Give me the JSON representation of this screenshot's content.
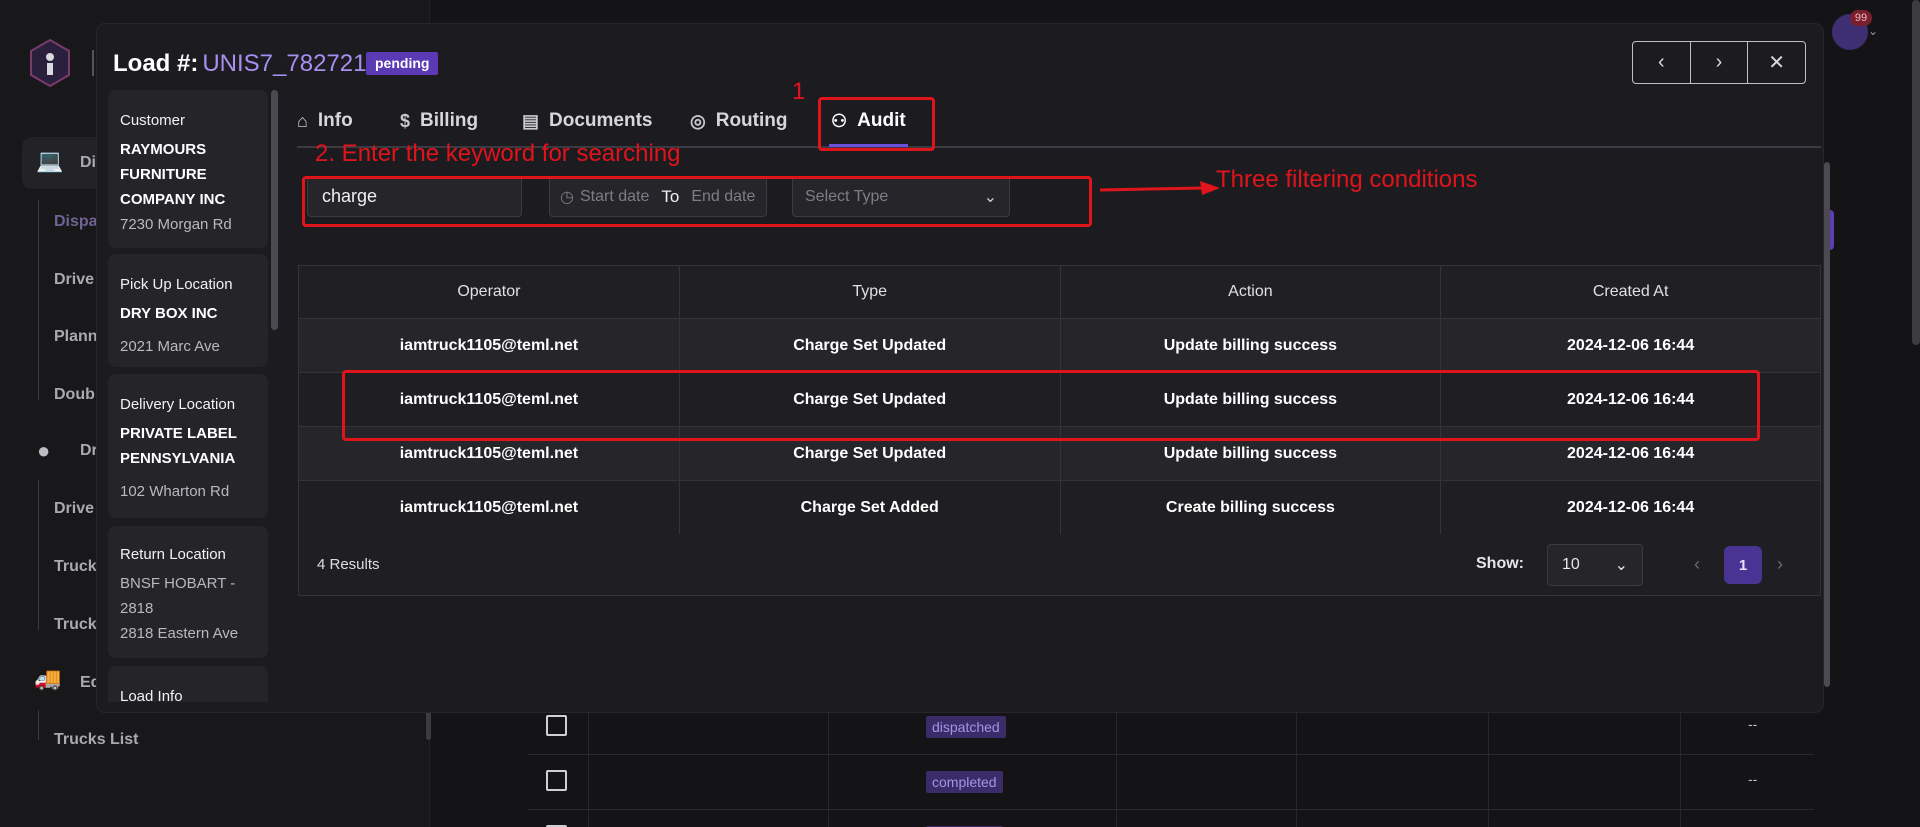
{
  "background": {
    "nav": {
      "group1_label": "Di",
      "dispatch_label": "Dispa",
      "drivers_label": "Drive",
      "planning_label": "Plann",
      "double_label": "Doub",
      "group2_label": "Dr",
      "drivers2_label": "Drive",
      "trucks1_label": "Truck",
      "trucks2_label": "Truck",
      "group3_label": "Eq",
      "trucks_list_label": "Trucks List"
    },
    "notification_count": "99",
    "rows": [
      {
        "status": "dispatched",
        "dash": "--"
      },
      {
        "status": "completed",
        "dash": "--"
      },
      {
        "status": "completed",
        "dash": "--"
      }
    ]
  },
  "modal": {
    "title_label": "Load #:",
    "load_id": "UNIS7_782721",
    "status_badge": "pending",
    "nav": {
      "prev": "‹",
      "next": "›",
      "close": "✕"
    },
    "info_cards": [
      {
        "title": "Customer",
        "name": "RAYMOURS FURNITURE COMPANY INC",
        "sub": "7230 Morgan Rd"
      },
      {
        "title": "Pick Up Location",
        "name": "DRY BOX INC",
        "sub": "2021 Marc Ave"
      },
      {
        "title": "Delivery Location",
        "name": "PRIVATE LABEL PENNSYLVANIA",
        "sub": "102 Wharton Rd"
      },
      {
        "title": "Return Location",
        "name": "",
        "sub": "BNSF HOBART - 2818",
        "sub2": "2818 Eastern Ave"
      },
      {
        "title": "Load Info",
        "name": "",
        "sub": ""
      }
    ],
    "tabs": [
      {
        "label": "Info",
        "icon": "home-icon"
      },
      {
        "label": "Billing",
        "icon": "dollar-icon"
      },
      {
        "label": "Documents",
        "icon": "document-icon"
      },
      {
        "label": "Routing",
        "icon": "crosshair-icon"
      },
      {
        "label": "Audit",
        "icon": "audit-icon",
        "active": true
      }
    ],
    "filters": {
      "keyword_value": "charge",
      "start_placeholder": "Start date",
      "to_label": "To",
      "end_placeholder": "End date",
      "type_placeholder": "Select Type"
    },
    "table": {
      "headers": [
        "Operator",
        "Type",
        "Action",
        "Created At"
      ],
      "rows": [
        [
          "iamtruck1105@teml.net",
          "Charge Set Updated",
          "Update billing success",
          "2024-12-06 16:44"
        ],
        [
          "iamtruck1105@teml.net",
          "Charge Set Updated",
          "Update billing success",
          "2024-12-06 16:44"
        ],
        [
          "iamtruck1105@teml.net",
          "Charge Set Updated",
          "Update billing success",
          "2024-12-06 16:44"
        ],
        [
          "iamtruck1105@teml.net",
          "Charge Set Added",
          "Create billing success",
          "2024-12-06 16:44"
        ]
      ]
    },
    "footer": {
      "results": "4 Results",
      "show_label": "Show:",
      "page_size": "10",
      "current_page": "1"
    }
  },
  "annotations": {
    "step1": "1",
    "step2": "2. Enter the keyword for searching",
    "filters_note": "Three filtering conditions"
  },
  "colors": {
    "accent": "#6d4fe0",
    "annotation_red": "#e0141b",
    "load_id": "#a68ff0"
  }
}
